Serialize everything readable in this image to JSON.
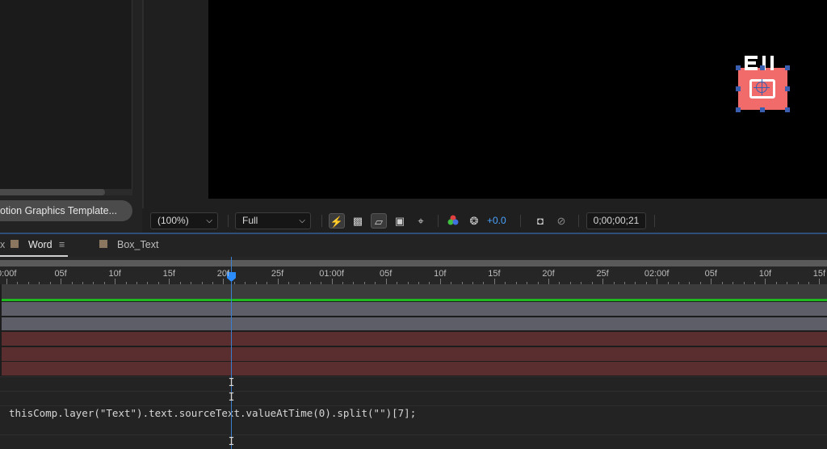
{
  "project_panel": {
    "mgt_button_label": "otion Graphics Template..."
  },
  "viewer": {
    "glyph_text": "Ell",
    "toolbar": {
      "magnification": "(100%)",
      "resolution": "Full",
      "exposure_value": "+0.0",
      "timecode": "0;00;00;21"
    }
  },
  "timeline": {
    "tabs": [
      {
        "label": "Word",
        "color": "#8b7760",
        "active": true
      },
      {
        "label": "Box_Text",
        "color": "#8b7760",
        "active": false
      }
    ],
    "tab_close_fragment": "x",
    "ruler_labels": [
      "0:00f",
      "05f",
      "10f",
      "15f",
      "20f",
      "25f",
      "01:00f",
      "05f",
      "10f",
      "15f",
      "20f",
      "25f",
      "02:00f",
      "05f",
      "10f",
      "15f"
    ],
    "expression": "thisComp.layer(\"Text\").text.sourceText.valueAtTime(0).split(\"\")[7];",
    "colors": {
      "green_track": "#1fb81f",
      "gray_layer": "#5d5e67",
      "red_layer": "#5a2e2e",
      "playhead": "#2a8cff"
    }
  }
}
